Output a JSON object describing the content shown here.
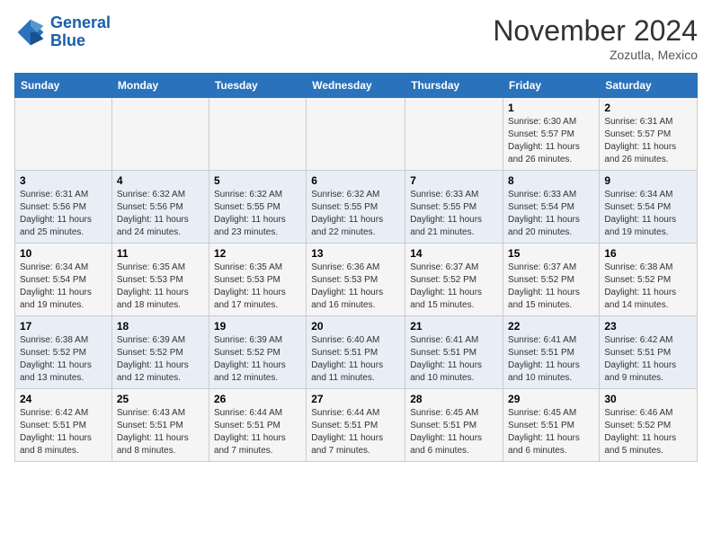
{
  "logo": {
    "line1": "General",
    "line2": "Blue"
  },
  "title": "November 2024",
  "location": "Zozutla, Mexico",
  "days_of_week": [
    "Sunday",
    "Monday",
    "Tuesday",
    "Wednesday",
    "Thursday",
    "Friday",
    "Saturday"
  ],
  "weeks": [
    [
      {
        "day": "",
        "info": ""
      },
      {
        "day": "",
        "info": ""
      },
      {
        "day": "",
        "info": ""
      },
      {
        "day": "",
        "info": ""
      },
      {
        "day": "",
        "info": ""
      },
      {
        "day": "1",
        "info": "Sunrise: 6:30 AM\nSunset: 5:57 PM\nDaylight: 11 hours and 26 minutes."
      },
      {
        "day": "2",
        "info": "Sunrise: 6:31 AM\nSunset: 5:57 PM\nDaylight: 11 hours and 26 minutes."
      }
    ],
    [
      {
        "day": "3",
        "info": "Sunrise: 6:31 AM\nSunset: 5:56 PM\nDaylight: 11 hours and 25 minutes."
      },
      {
        "day": "4",
        "info": "Sunrise: 6:32 AM\nSunset: 5:56 PM\nDaylight: 11 hours and 24 minutes."
      },
      {
        "day": "5",
        "info": "Sunrise: 6:32 AM\nSunset: 5:55 PM\nDaylight: 11 hours and 23 minutes."
      },
      {
        "day": "6",
        "info": "Sunrise: 6:32 AM\nSunset: 5:55 PM\nDaylight: 11 hours and 22 minutes."
      },
      {
        "day": "7",
        "info": "Sunrise: 6:33 AM\nSunset: 5:55 PM\nDaylight: 11 hours and 21 minutes."
      },
      {
        "day": "8",
        "info": "Sunrise: 6:33 AM\nSunset: 5:54 PM\nDaylight: 11 hours and 20 minutes."
      },
      {
        "day": "9",
        "info": "Sunrise: 6:34 AM\nSunset: 5:54 PM\nDaylight: 11 hours and 19 minutes."
      }
    ],
    [
      {
        "day": "10",
        "info": "Sunrise: 6:34 AM\nSunset: 5:54 PM\nDaylight: 11 hours and 19 minutes."
      },
      {
        "day": "11",
        "info": "Sunrise: 6:35 AM\nSunset: 5:53 PM\nDaylight: 11 hours and 18 minutes."
      },
      {
        "day": "12",
        "info": "Sunrise: 6:35 AM\nSunset: 5:53 PM\nDaylight: 11 hours and 17 minutes."
      },
      {
        "day": "13",
        "info": "Sunrise: 6:36 AM\nSunset: 5:53 PM\nDaylight: 11 hours and 16 minutes."
      },
      {
        "day": "14",
        "info": "Sunrise: 6:37 AM\nSunset: 5:52 PM\nDaylight: 11 hours and 15 minutes."
      },
      {
        "day": "15",
        "info": "Sunrise: 6:37 AM\nSunset: 5:52 PM\nDaylight: 11 hours and 15 minutes."
      },
      {
        "day": "16",
        "info": "Sunrise: 6:38 AM\nSunset: 5:52 PM\nDaylight: 11 hours and 14 minutes."
      }
    ],
    [
      {
        "day": "17",
        "info": "Sunrise: 6:38 AM\nSunset: 5:52 PM\nDaylight: 11 hours and 13 minutes."
      },
      {
        "day": "18",
        "info": "Sunrise: 6:39 AM\nSunset: 5:52 PM\nDaylight: 11 hours and 12 minutes."
      },
      {
        "day": "19",
        "info": "Sunrise: 6:39 AM\nSunset: 5:52 PM\nDaylight: 11 hours and 12 minutes."
      },
      {
        "day": "20",
        "info": "Sunrise: 6:40 AM\nSunset: 5:51 PM\nDaylight: 11 hours and 11 minutes."
      },
      {
        "day": "21",
        "info": "Sunrise: 6:41 AM\nSunset: 5:51 PM\nDaylight: 11 hours and 10 minutes."
      },
      {
        "day": "22",
        "info": "Sunrise: 6:41 AM\nSunset: 5:51 PM\nDaylight: 11 hours and 10 minutes."
      },
      {
        "day": "23",
        "info": "Sunrise: 6:42 AM\nSunset: 5:51 PM\nDaylight: 11 hours and 9 minutes."
      }
    ],
    [
      {
        "day": "24",
        "info": "Sunrise: 6:42 AM\nSunset: 5:51 PM\nDaylight: 11 hours and 8 minutes."
      },
      {
        "day": "25",
        "info": "Sunrise: 6:43 AM\nSunset: 5:51 PM\nDaylight: 11 hours and 8 minutes."
      },
      {
        "day": "26",
        "info": "Sunrise: 6:44 AM\nSunset: 5:51 PM\nDaylight: 11 hours and 7 minutes."
      },
      {
        "day": "27",
        "info": "Sunrise: 6:44 AM\nSunset: 5:51 PM\nDaylight: 11 hours and 7 minutes."
      },
      {
        "day": "28",
        "info": "Sunrise: 6:45 AM\nSunset: 5:51 PM\nDaylight: 11 hours and 6 minutes."
      },
      {
        "day": "29",
        "info": "Sunrise: 6:45 AM\nSunset: 5:51 PM\nDaylight: 11 hours and 6 minutes."
      },
      {
        "day": "30",
        "info": "Sunrise: 6:46 AM\nSunset: 5:52 PM\nDaylight: 11 hours and 5 minutes."
      }
    ]
  ]
}
